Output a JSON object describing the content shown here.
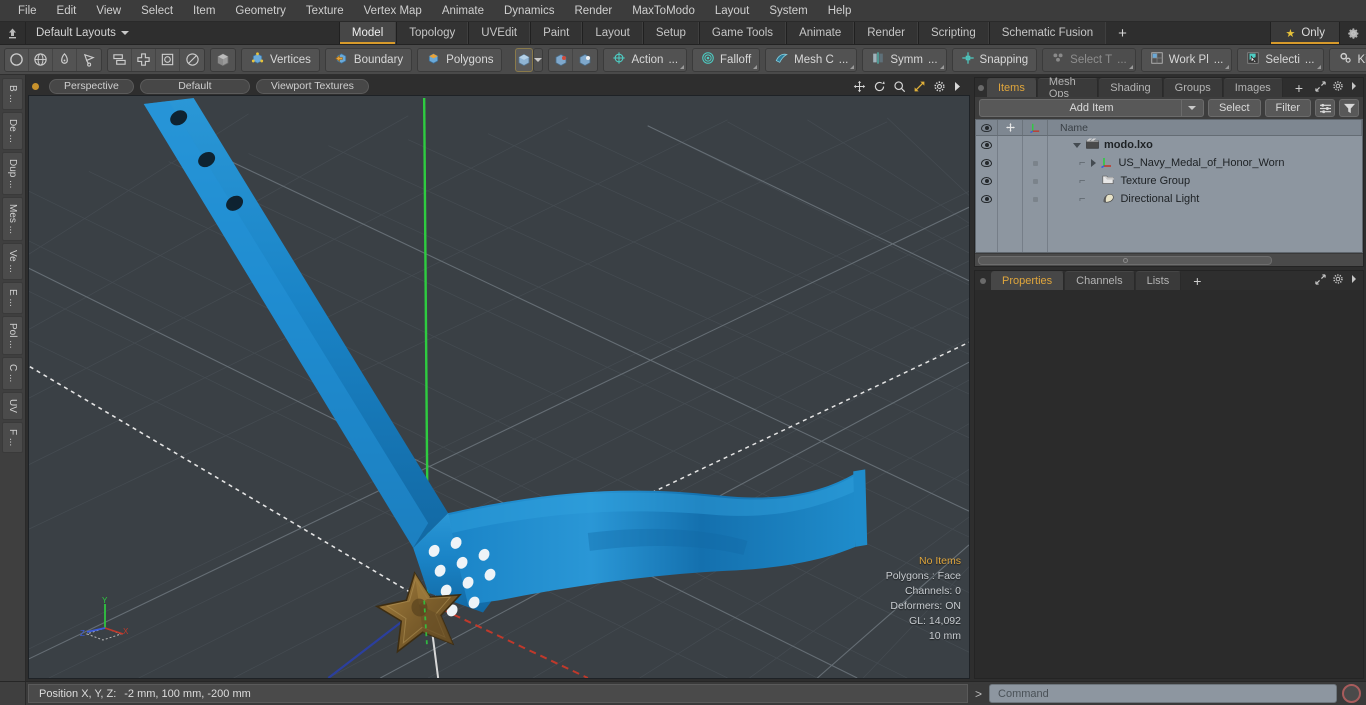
{
  "menu": {
    "items": [
      "File",
      "Edit",
      "View",
      "Select",
      "Item",
      "Geometry",
      "Texture",
      "Vertex Map",
      "Animate",
      "Dynamics",
      "Render",
      "MaxToModo",
      "Layout",
      "System",
      "Help"
    ]
  },
  "layout_bar": {
    "layouts_label": "Default Layouts",
    "home_icon": "home-arrow-icon",
    "tabs": [
      {
        "label": "Model",
        "active": true
      },
      {
        "label": "Topology",
        "active": false
      },
      {
        "label": "UVEdit",
        "active": false
      },
      {
        "label": "Paint",
        "active": false
      },
      {
        "label": "Layout",
        "active": false
      },
      {
        "label": "Setup",
        "active": false
      },
      {
        "label": "Game Tools",
        "active": false
      },
      {
        "label": "Animate",
        "active": false
      },
      {
        "label": "Render",
        "active": false
      },
      {
        "label": "Scripting",
        "active": false
      },
      {
        "label": "Schematic Fusion",
        "active": false
      }
    ],
    "add_tab_label": "+",
    "only_label": "Only",
    "only_icon": "star-icon",
    "gear_icon": "gear-icon",
    "accent_color": "#d79a2b"
  },
  "toolbar": {
    "shape_icons": [
      "circle-icon",
      "globe-icon",
      "pen-icon",
      "lasso-icon"
    ],
    "transform_icons": [
      "stack-icon",
      "move-icon",
      "square-target-icon",
      "disc-icon"
    ],
    "cube_icon": "cube-icon",
    "mode_buttons": [
      {
        "label": "Vertices",
        "icon": "vertex-cube-icon"
      },
      {
        "label": "Boundary",
        "icon": "boundary-cube-icon"
      },
      {
        "label": "Polygons",
        "icon": "polygon-cube-icon"
      }
    ],
    "selected_cube_icon": "selected-cube-icon",
    "dropdown_icon": "chevron-down-icon",
    "small_cube_icons": [
      "cube-red-icon",
      "cube-white-icon"
    ],
    "tool_buttons": [
      {
        "label": "Action",
        "suffix": "...",
        "icon": "action-center-icon",
        "dim": false
      },
      {
        "label": "Falloff",
        "suffix": "",
        "icon": "falloff-icon",
        "dim": false
      },
      {
        "label": "Mesh C",
        "suffix": "...",
        "icon": "mesh-constraint-icon",
        "dim": false
      },
      {
        "label": "Symm",
        "suffix": "...",
        "icon": "symmetry-icon",
        "dim": false
      },
      {
        "label": "Snapping",
        "suffix": "",
        "icon": "snapping-icon",
        "dim": false
      },
      {
        "label": "Select T",
        "suffix": "...",
        "icon": "select-through-icon",
        "dim": true
      },
      {
        "label": "Work Pl",
        "suffix": "...",
        "icon": "work-plane-icon",
        "dim": false
      },
      {
        "label": "Selecti",
        "suffix": "...",
        "icon": "selection-set-icon",
        "dim": false
      }
    ],
    "kits_label": "Kits",
    "kits_icon": "gears-icon",
    "round_icons": [
      "modo-logo-icon",
      "unreal-logo-icon"
    ]
  },
  "left_strip": {
    "tabs": [
      "B ...",
      "De ...",
      "Dup ...",
      "Mes ...",
      "Ve ...",
      "E ...",
      "Pol ...",
      "C ...",
      "UV",
      "F ..."
    ]
  },
  "viewport": {
    "header": {
      "dot_icon": "orange-dot-icon",
      "view_mode": "Perspective",
      "shading_preset": "Default",
      "texture_mode": "Viewport Textures",
      "icons": [
        "pan-icon",
        "rotate-icon",
        "zoom-icon",
        "fit-icon",
        "gear-icon",
        "chevron-right-icon"
      ]
    },
    "stats": {
      "selection": "No Items",
      "polygons": "Polygons : Face",
      "channels": "Channels: 0",
      "deformers": "Deformers: ON",
      "gl": "GL: 14,092",
      "grid_size": "10 mm"
    },
    "axis_labels": {
      "x": "X",
      "y": "Y",
      "z": "Z"
    },
    "axis_colors": {
      "x": "#c0392b",
      "y": "#2ecc40",
      "z": "#3b5bdb"
    },
    "background_color": "#3a4045",
    "model": {
      "ribbon_color": "#1a84c7",
      "medal_color": "#8a6a33",
      "name": "US Navy Medal of Honor"
    }
  },
  "items_panel": {
    "tabs": [
      {
        "label": "Items",
        "active": true
      },
      {
        "label": "Mesh Ops",
        "active": false
      },
      {
        "label": "Shading",
        "active": false
      },
      {
        "label": "Groups",
        "active": false
      },
      {
        "label": "Images",
        "active": false
      },
      {
        "label": "+",
        "active": false
      }
    ],
    "header_icons": [
      "expand-icon",
      "gear-icon",
      "chevron-right-icon"
    ],
    "add_item_label": "Add Item",
    "select_label": "Select",
    "filter_label": "Filter",
    "list_icon": "list-options-icon",
    "funnel_icon": "funnel-icon",
    "columns": [
      "eye-icon",
      "move-icon",
      "axis-icon",
      "Name"
    ],
    "rows": [
      {
        "name": "modo.lxo",
        "icon": "scene-icon",
        "depth": 0,
        "expanded": true,
        "bold": true
      },
      {
        "name": "US_Navy_Medal_of_Honor_Worn",
        "icon": "mesh-icon",
        "depth": 1,
        "expanded": false,
        "bold": false
      },
      {
        "name": "Texture Group",
        "icon": "texture-group-icon",
        "depth": 1,
        "expanded": null,
        "bold": false
      },
      {
        "name": "Directional Light",
        "icon": "light-icon",
        "depth": 1,
        "expanded": null,
        "bold": false
      }
    ]
  },
  "properties_panel": {
    "tabs": [
      {
        "label": "Properties",
        "active": true
      },
      {
        "label": "Channels",
        "active": false
      },
      {
        "label": "Lists",
        "active": false
      },
      {
        "label": "+",
        "active": false
      }
    ],
    "header_icons": [
      "expand-icon",
      "gear-icon",
      "chevron-right-icon"
    ]
  },
  "status_bar": {
    "position_label": "Position X, Y, Z:",
    "position_value": "-2 mm, 100 mm, -200 mm",
    "command_prompt": ">",
    "command_placeholder": "Command",
    "record_icon": "record-icon"
  }
}
